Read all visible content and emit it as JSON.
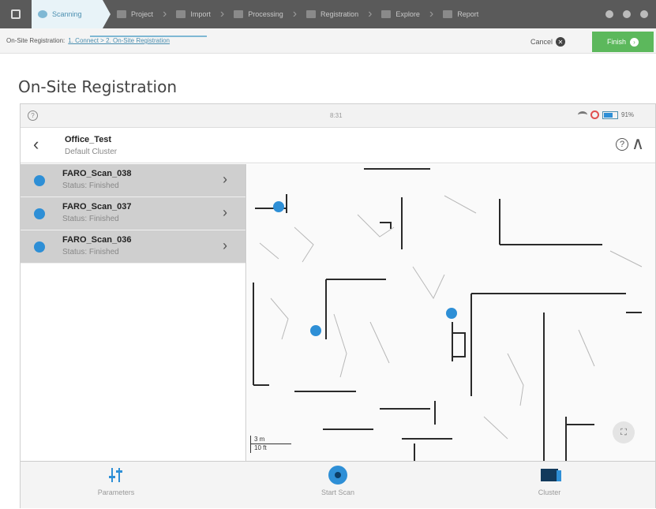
{
  "topbar": {
    "steps": [
      {
        "label": "Scanning",
        "icon": "scanner-icon"
      },
      {
        "label": "Project",
        "icon": "folder-icon"
      },
      {
        "label": "Import",
        "icon": "import-icon"
      },
      {
        "label": "Processing",
        "icon": "processing-icon"
      },
      {
        "label": "Registration",
        "icon": "registration-icon"
      },
      {
        "label": "Explore",
        "icon": "explore-icon"
      },
      {
        "label": "Report",
        "icon": "report-icon"
      }
    ]
  },
  "breadcrumb": {
    "prefix": "On-Site Registration:",
    "link": "1. Connect > 2. On-Site Registration",
    "cancel_label": "Cancel",
    "finish_label": "Finish"
  },
  "page": {
    "title": "On-Site Registration"
  },
  "device": {
    "status": {
      "time": "8:31",
      "battery": "91%"
    },
    "header": {
      "project_name": "Office_Test",
      "cluster": "Default Cluster"
    },
    "scans": [
      {
        "name": "FARO_Scan_038",
        "status": "Status: Finished"
      },
      {
        "name": "FARO_Scan_037",
        "status": "Status: Finished"
      },
      {
        "name": "FARO_Scan_036",
        "status": "Status: Finished"
      }
    ],
    "map": {
      "scale_metric": "3 m",
      "scale_imperial": "10 ft"
    },
    "nav": {
      "parameters": "Parameters",
      "start_scan": "Start Scan",
      "cluster": "Cluster"
    }
  },
  "colors": {
    "accent": "#2e8fd6",
    "finish": "#5cb85c",
    "topbar": "#5a5a5a"
  }
}
